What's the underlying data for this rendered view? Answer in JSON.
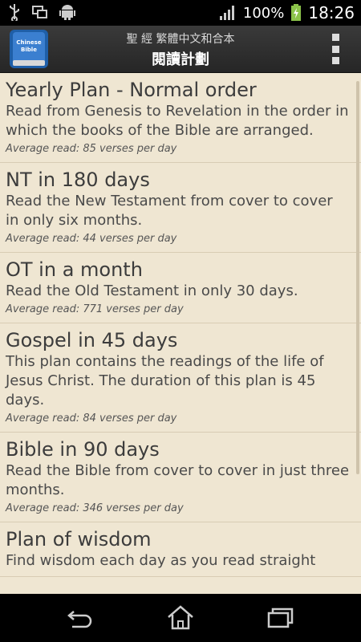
{
  "status_bar": {
    "battery_percent": "100%",
    "time": "18:26",
    "icons": [
      "usb-icon",
      "screen-icon",
      "android-icon",
      "signal-icon",
      "battery-charging-icon"
    ]
  },
  "action_bar": {
    "app_icon_text": "Chinese Bible",
    "title_line1": "聖 經 繁體中文和合本",
    "title_line2": "閱讀計劃",
    "overflow_icon": "overflow-menu-icon"
  },
  "plans": [
    {
      "title": "Yearly Plan - Normal order",
      "description": "Read from Genesis to Revelation in the order in which the books of the Bible are arranged.",
      "average": "Average read: 85 verses per day"
    },
    {
      "title": "NT in 180 days",
      "description": "Read the New Testament from cover to cover in only six months.",
      "average": "Average read: 44 verses per day"
    },
    {
      "title": "OT in a month",
      "description": "Read the Old Testament in only 30 days.",
      "average": "Average read: 771 verses per day"
    },
    {
      "title": "Gospel in 45 days",
      "description": "This plan contains the readings of the life of Jesus Christ. The duration of this plan is 45 days.",
      "average": "Average read: 84 verses per day"
    },
    {
      "title": "Bible in 90 days",
      "description": "Read the Bible from cover to cover in just three months.",
      "average": "Average read: 346 verses per day"
    },
    {
      "title": "Plan of wisdom",
      "description": "Find wisdom each day as you read straight",
      "average": ""
    }
  ],
  "nav_bar": {
    "icons": [
      "back-icon",
      "home-icon",
      "recent-apps-icon"
    ]
  },
  "colors": {
    "content_background": "#efe6d2",
    "action_bar": "#2f2f2f",
    "text": "#3c3c3c"
  }
}
